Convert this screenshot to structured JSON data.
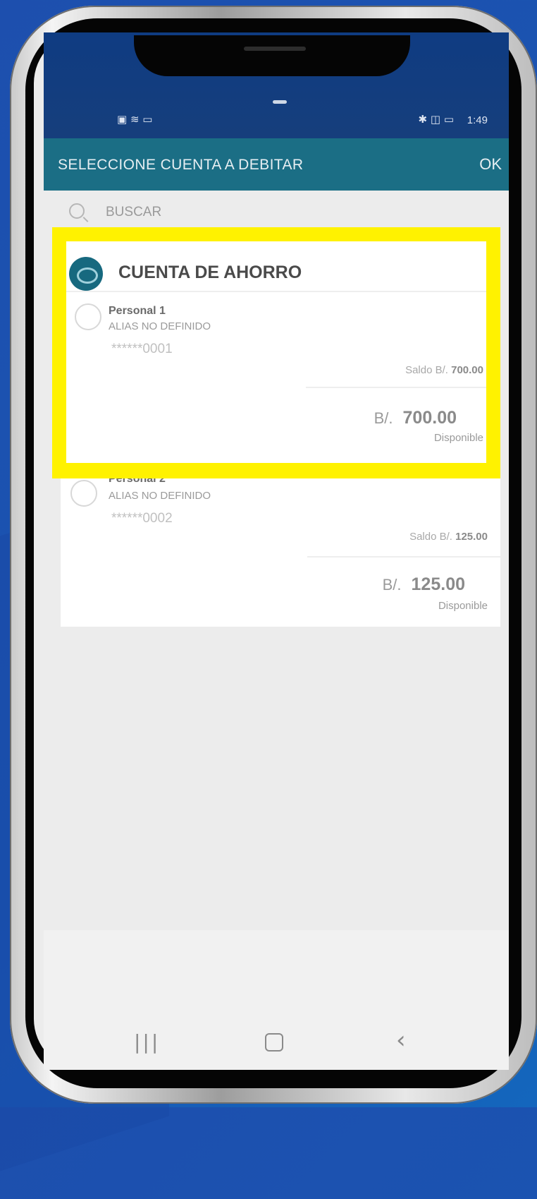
{
  "status_bar": {
    "time": "1:49",
    "left_icons": "▣ ≋ ▭",
    "right_icons": "✱ ◫ ▭"
  },
  "appbar": {
    "title": "SELECCIONE CUENTA A DEBITAR",
    "ok_label": "OK"
  },
  "search": {
    "placeholder": "BUSCAR",
    "icon": "search-icon"
  },
  "section": {
    "title": "CUENTA DE AHORRO",
    "icon": "piggy-bank-icon"
  },
  "accounts": [
    {
      "name": "Personal 1",
      "alias": "ALIAS NO DEFINIDO",
      "number": "******0001",
      "saldo_label": "Saldo B/.",
      "saldo_value": "700.00",
      "currency": "B/.",
      "available": "700.00",
      "available_label": "Disponible"
    },
    {
      "name": "Personal 2",
      "alias": "ALIAS NO DEFINIDO",
      "number": "******0002",
      "saldo_label": "Saldo B/.",
      "saldo_value": "125.00",
      "currency": "B/.",
      "available": "125.00",
      "available_label": "Disponible"
    }
  ],
  "navbar": {
    "recent": "|||",
    "back": "‹"
  },
  "colors": {
    "appbar": "#1b6e85",
    "status_bar": "#0f3c82",
    "highlight": "#fff200",
    "background": "#1d4fae"
  }
}
